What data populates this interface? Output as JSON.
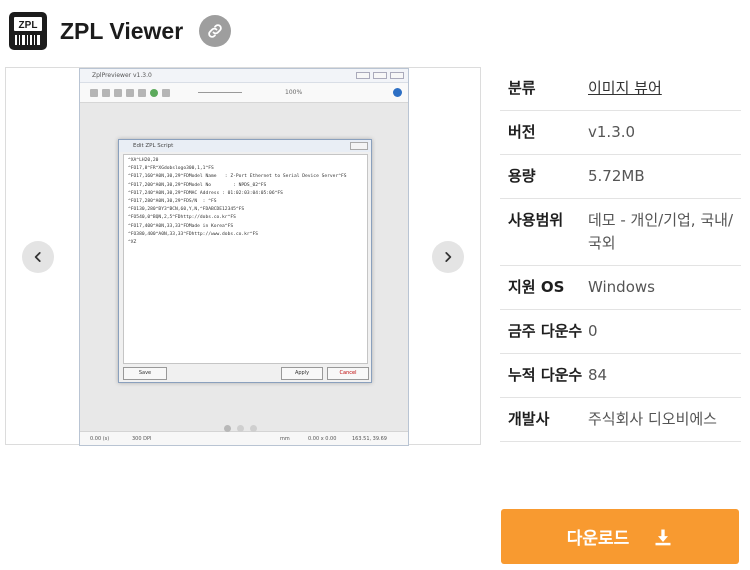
{
  "header": {
    "logo_text": "ZPL",
    "title": "ZPL Viewer"
  },
  "gallery": {
    "dot_count": 3,
    "active_dot": 0,
    "screenshot": {
      "window_title": "ZplPreviewer v1.3.0",
      "zoom": "100%",
      "dialog_title": "Edit ZPL Script",
      "script_lines": [
        "^XA^LH20,20",
        "^FO17,8^FR^XGdobslogo300,1,1^FS",
        "^FO17,160^A0N,30,29^FDModel Name   : Z-Port Ethernet to Serial Device Server^FS",
        "^FO17,200^A0N,30,29^FDModel No        : NPDS_02^FS",
        "^FO17,240^A0N,30,29^FDMAC Address : 01:02:03:04:05:06^FS",
        "^FO17,280^A0N,30,29^FDS/N  : ^FS",
        "^FO130,280^BY3^BCN,60,Y,N,^FDABCDE12345^FS",
        "^FO540,0^BQN,2,5^FDhttp://dobs.co.kr^FS",
        "^FO17,400^A0N,33,33^FDMade in Korea^FS",
        "^FO380,400^A0N,33,33^FDhttp://www.dobs.co.kr^FS",
        "^XZ"
      ],
      "save_label": "Save",
      "apply_label": "Apply",
      "cancel_label": "Cancel",
      "status_time": "0.00 (s)",
      "status_dpi": "300 DPI",
      "status_unit": "mm",
      "status_size": "0.00 x 0.00",
      "status_coords": "163.51, 39.69"
    }
  },
  "info": {
    "rows": [
      {
        "label": "분류",
        "value": "이미지 뷰어"
      },
      {
        "label": "버전",
        "value": "v1.3.0"
      },
      {
        "label": "용량",
        "value": "5.72MB"
      },
      {
        "label": "사용범위",
        "value": "데모 - 개인/기업, 국내/국외"
      },
      {
        "label": "지원 OS",
        "value": "Windows"
      },
      {
        "label": "금주 다운수",
        "value": "0"
      },
      {
        "label": "누적 다운수",
        "value": "84"
      },
      {
        "label": "개발사",
        "value": "주식회사 디오비에스"
      }
    ]
  },
  "download": {
    "label": "다운로드"
  },
  "colors": {
    "accent": "#f89a30",
    "link_button": "#9e9e9e"
  }
}
